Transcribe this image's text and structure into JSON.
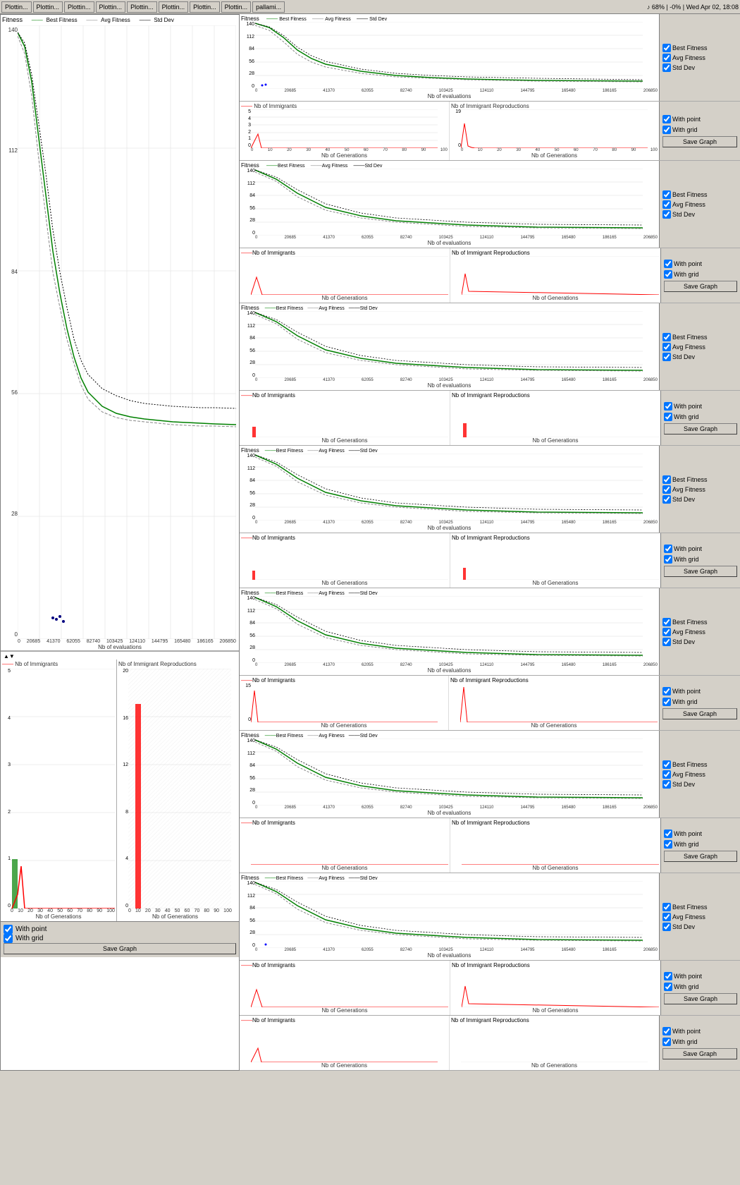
{
  "taskbar": {
    "items": [
      "Plottin...",
      "Plottin...",
      "Plottin...",
      "Plottin...",
      "Plottin...",
      "Plottin...",
      "Plottin...",
      "Plottin...",
      "pallami..."
    ],
    "status": "♪ 68% | -0% | Wed Apr 02, 18:08"
  },
  "left_graph": {
    "title": "Fitness",
    "y_labels": [
      "140",
      "112",
      "84",
      "56",
      "28",
      "0"
    ],
    "x_labels": [
      "0",
      "20685",
      "41370",
      "62055",
      "82740",
      "103425",
      "124110",
      "144795",
      "165480",
      "186165",
      "206850"
    ],
    "x_axis_label": "Nb of evaluations",
    "legend": [
      {
        "label": "Best Fitness",
        "color": "green"
      },
      {
        "label": "Avg Fitness",
        "color": "gray"
      },
      {
        "label": "Std Dev",
        "color": "black"
      }
    ]
  },
  "left_mini": {
    "immigrants_title": "Nb of Immigrants",
    "reproductions_title": "Nb of Immigrant Reproductions",
    "immigrants_y": [
      "5",
      "4",
      "3",
      "2",
      "1",
      "0"
    ],
    "reproductions_y": [
      "20",
      "16",
      "12",
      "8",
      "4",
      "0"
    ],
    "x_labels": [
      "0",
      "10",
      "20",
      "30",
      "40",
      "50",
      "60",
      "70",
      "80",
      "90",
      "100"
    ],
    "x_axis_label": "Nb of Generations"
  },
  "right_rows": [
    {
      "id": 0,
      "checkboxes": [
        {
          "label": "Best Fitness",
          "checked": true
        },
        {
          "label": "Avg Fitness",
          "checked": true
        },
        {
          "label": "Std Dev",
          "checked": true
        }
      ],
      "with_point": false,
      "with_grid": false,
      "show_controls": false
    },
    {
      "id": 1,
      "checkboxes": [
        {
          "label": "With point",
          "checked": true
        },
        {
          "label": "With grid",
          "checked": true
        }
      ],
      "save_label": "Save Graph",
      "show_controls": true
    },
    {
      "id": 2,
      "checkboxes": [
        {
          "label": "Best Fitness",
          "checked": true
        },
        {
          "label": "Avg Fitness",
          "checked": true
        },
        {
          "label": "Std Dev",
          "checked": true
        }
      ],
      "with_point": false,
      "with_grid": false,
      "show_controls": false
    },
    {
      "id": 3,
      "checkboxes": [
        {
          "label": "With point",
          "checked": true
        },
        {
          "label": "With grid",
          "checked": true
        }
      ],
      "save_label": "Save Graph",
      "show_controls": true
    },
    {
      "id": 4,
      "checkboxes": [
        {
          "label": "Best Fitness",
          "checked": true
        },
        {
          "label": "Avg Fitness",
          "checked": true
        },
        {
          "label": "Std Dev",
          "checked": true
        }
      ],
      "with_point": false,
      "with_grid": false,
      "show_controls": false
    },
    {
      "id": 5,
      "checkboxes": [
        {
          "label": "With point",
          "checked": true
        },
        {
          "label": "With grid",
          "checked": true
        }
      ],
      "save_label": "Save Graph",
      "show_controls": true
    },
    {
      "id": 6,
      "checkboxes": [
        {
          "label": "Best Fitness",
          "checked": true
        },
        {
          "label": "Avg Fitness",
          "checked": true
        },
        {
          "label": "Std Dev",
          "checked": true
        }
      ],
      "with_point": false,
      "with_grid": false,
      "show_controls": false
    },
    {
      "id": 7,
      "checkboxes": [
        {
          "label": "With point",
          "checked": true
        },
        {
          "label": "With grid",
          "checked": true
        }
      ],
      "save_label": "Save Graph",
      "show_controls": true
    },
    {
      "id": 8,
      "checkboxes": [
        {
          "label": "Best Fitness",
          "checked": true
        },
        {
          "label": "Avg Fitness",
          "checked": true
        },
        {
          "label": "Std Dev",
          "checked": true
        }
      ],
      "with_point": false,
      "with_grid": false,
      "show_controls": false
    },
    {
      "id": 9,
      "checkboxes": [
        {
          "label": "With point",
          "checked": true
        },
        {
          "label": "With grid",
          "checked": true
        }
      ],
      "save_label": "Save Graph",
      "show_controls": true
    },
    {
      "id": 10,
      "checkboxes": [
        {
          "label": "Best Fitness",
          "checked": true
        },
        {
          "label": "Avg Fitness",
          "checked": true
        },
        {
          "label": "Std Dev",
          "checked": true
        }
      ],
      "with_point": false,
      "with_grid": false,
      "show_controls": false
    },
    {
      "id": 11,
      "checkboxes": [
        {
          "label": "With point",
          "checked": true
        },
        {
          "label": "With grid",
          "checked": true
        }
      ],
      "save_label": "Save Graph",
      "show_controls": true
    },
    {
      "id": 12,
      "checkboxes": [
        {
          "label": "Best Fitness",
          "checked": true
        },
        {
          "label": "Avg Fitness",
          "checked": true
        },
        {
          "label": "Std Dev",
          "checked": true
        }
      ],
      "with_point": false,
      "with_grid": false,
      "show_controls": false
    },
    {
      "id": 13,
      "checkboxes": [
        {
          "label": "With point",
          "checked": true
        },
        {
          "label": "With grid",
          "checked": true
        }
      ],
      "save_label": "Save Graph",
      "show_controls": true
    },
    {
      "id": 14,
      "checkboxes": [
        {
          "label": "Best Fitness",
          "checked": true
        },
        {
          "label": "Avg Fitness",
          "checked": true
        },
        {
          "label": "Std Dev",
          "checked": true
        }
      ],
      "with_point": false,
      "with_grid": false,
      "show_controls": false
    },
    {
      "id": 15,
      "checkboxes": [
        {
          "label": "With point",
          "checked": true
        },
        {
          "label": "With grid",
          "checked": true
        }
      ],
      "save_label": "Save Graph",
      "show_controls": true
    }
  ],
  "labels": {
    "best_fitness": "Best Fitness",
    "avg_fitness": "Avg Fitness",
    "std_dev": "Std Dev",
    "with_point": "With point",
    "with_grid": "With grid",
    "save_graph": "Save Graph",
    "nb_immigrants": "Nb of Immigrants",
    "nb_immigrant_reproductions": "Nb of Immigrant Reproductions",
    "nb_evaluations": "Nb of evaluations",
    "nb_generations": "Nb of Generations",
    "fitness": "Fitness",
    "immigrants_y_title": "of Immigrants"
  },
  "colors": {
    "best_fitness": "#00aa00",
    "avg_fitness": "#888888",
    "std_dev": "#000000",
    "immigrants": "#ff0000",
    "reproductions": "#ff0000",
    "grid": "#dddddd",
    "bg": "#ffffff"
  }
}
